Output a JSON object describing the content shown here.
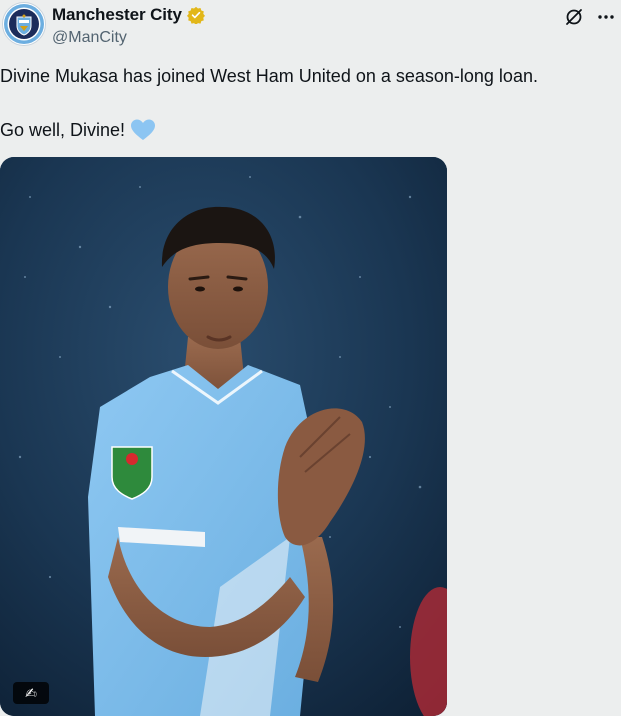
{
  "author": {
    "display_name": "Manchester City",
    "handle": "@ManCity",
    "avatar_icon": "manchester-city-crest",
    "verified_icon": "gold-verified-badge-icon",
    "verified_color": "#e2b719"
  },
  "actions": {
    "grok_icon": "grok-slash-icon",
    "more_icon": "more-options-icon",
    "more_label": "···"
  },
  "post": {
    "line1": "Divine Mukasa has joined West Ham United on a season-long loan.",
    "line2": "Go well, Divine!",
    "heart_emoji": "light-blue-heart",
    "heart_color": "#8cc5f2"
  },
  "media": {
    "description_icon": "photo-of-player-applauding",
    "badge_label": "✍",
    "kit_color": "#79b9ea",
    "background_color": "#17314a"
  }
}
